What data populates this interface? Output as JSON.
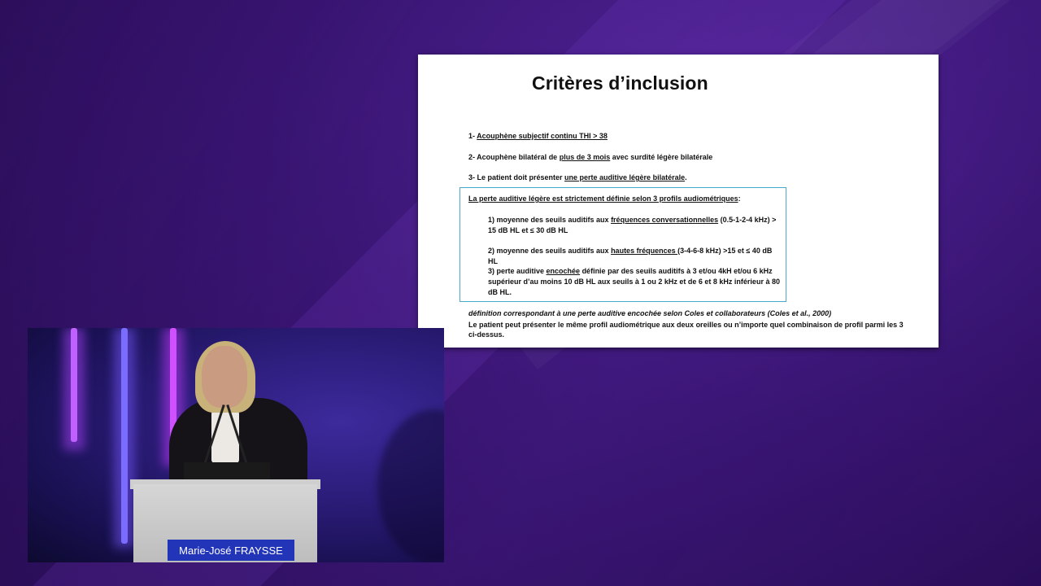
{
  "slide": {
    "title": "Critères d’inclusion",
    "criteria": [
      {
        "prefix": "1- ",
        "u1": "Acouphène subjectif continu  THI > 38"
      },
      {
        "prefix": "2- Acouphène bilatéral de ",
        "u1": "plus de 3 mois",
        "suffix": " avec surdité légère bilatérale"
      },
      {
        "prefix": "3- Le patient doit présenter ",
        "u1": "une perte auditive légère bilatérale",
        "suffix": "."
      }
    ],
    "definition_box": {
      "heading": "La perte auditive légère est strictement définie selon 3 profils audiométriques",
      "heading_suffix": ":",
      "profiles": [
        {
          "a": "1) moyenne des seuils auditifs aux ",
          "u": "fréquences conversationnelles",
          "b": " (0.5-1-2-4 kHz) > 15 dB HL et ≤ 30 dB HL"
        },
        {
          "a": "2) moyenne des seuils auditifs aux ",
          "u": "hautes fréquences ",
          "b": "(3-4-6-8 kHz) >15 et ≤ 40 dB HL"
        },
        {
          "a": "3) perte auditive ",
          "u": "encochée",
          "b": " définie par des seuils auditifs à 3 et/ou 4kH et/ou 6 kHz supérieur d’au  moins 10 dB HL aux seuils à 1 ou 2 kHz et de 6 et 8 kHz  inférieur à 80 dB HL."
        }
      ]
    },
    "note_italic": "définition correspondant à une  perte auditive encochée selon Coles et collaborateurs (Coles et al., 2000)",
    "note": "Le patient peut présenter le même profil audiométrique aux deux oreilles ou n’importe quel combinaison de profil parmi les 3 ci-dessus."
  },
  "camera": {
    "speaker_name": "Marie-José FRAYSSE"
  },
  "colors": {
    "background": "#34126a",
    "box_border": "#4aa9c9",
    "name_plate": "#2234b8",
    "stage_light": "#b043ff"
  }
}
